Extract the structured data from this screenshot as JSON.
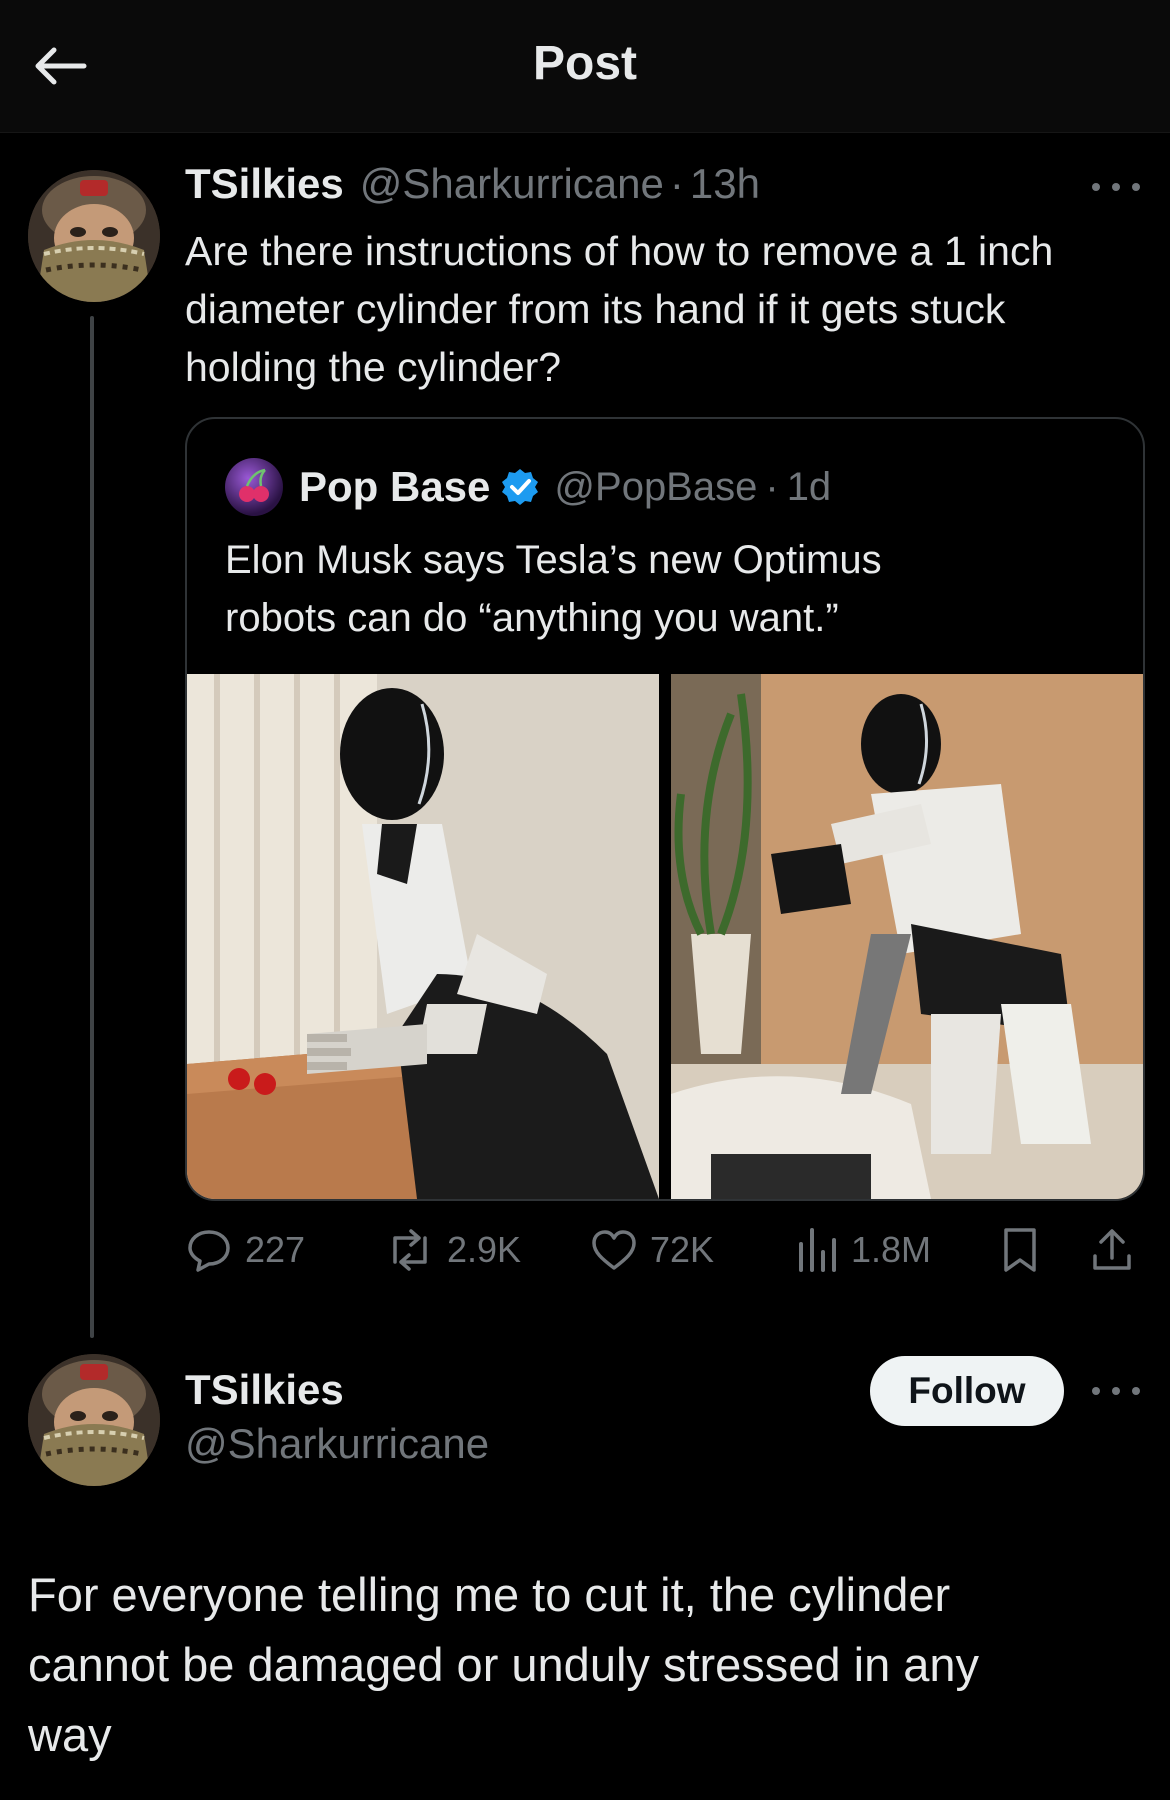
{
  "header": {
    "title": "Post"
  },
  "reply": {
    "name": "TSilkies",
    "handle": "@Sharkurricane",
    "separator": "·",
    "time": "13h",
    "text": "Are there instructions of how to remove a 1 inch\ndiameter cylinder from its hand if it gets stuck\nholding the cylinder?"
  },
  "quote": {
    "name": "Pop Base",
    "handle": "@PopBase",
    "separator": "·",
    "time": "1d",
    "text": "Elon Musk says Tesla’s new Optimus\nrobots can do “anything you want.”"
  },
  "actions": {
    "replies": "227",
    "reposts": "2.9K",
    "likes": "72K",
    "views": "1.8M"
  },
  "main_post": {
    "name": "TSilkies",
    "handle": "@Sharkurricane",
    "follow_label": "Follow",
    "text": "For everyone telling me to cut it, the cylinder\ncannot be damaged or unduly stressed in any\nway"
  },
  "colors": {
    "background": "#000000",
    "text_primary": "#e7e9ea",
    "text_secondary": "#71767b",
    "verified": "#1d9bf0",
    "follow_bg": "#eff3f4"
  }
}
